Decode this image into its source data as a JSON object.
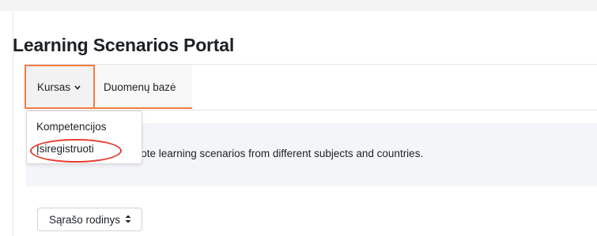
{
  "page": {
    "title": "Learning Scenarios Portal"
  },
  "nav": {
    "tabs": [
      {
        "label": "Kursas",
        "icon": "chevron-down-icon",
        "active": true
      },
      {
        "label": "Duomenų bazė",
        "active": false
      }
    ]
  },
  "dropdown": {
    "items": [
      {
        "label": "Kompetencijos"
      },
      {
        "label": "Įsiregistruoti",
        "highlighted": true
      }
    ]
  },
  "description": {
    "text": "romote learning scenarios from different subjects and countries."
  },
  "view_select": {
    "selected": "Sąrašo rodinys",
    "icon": "sort-updown-icon"
  },
  "colors": {
    "tab_highlight": "#f47c44",
    "annotation_circle": "#e63c2e",
    "description_bg": "#f4f5f8",
    "text": "#1d2125"
  }
}
